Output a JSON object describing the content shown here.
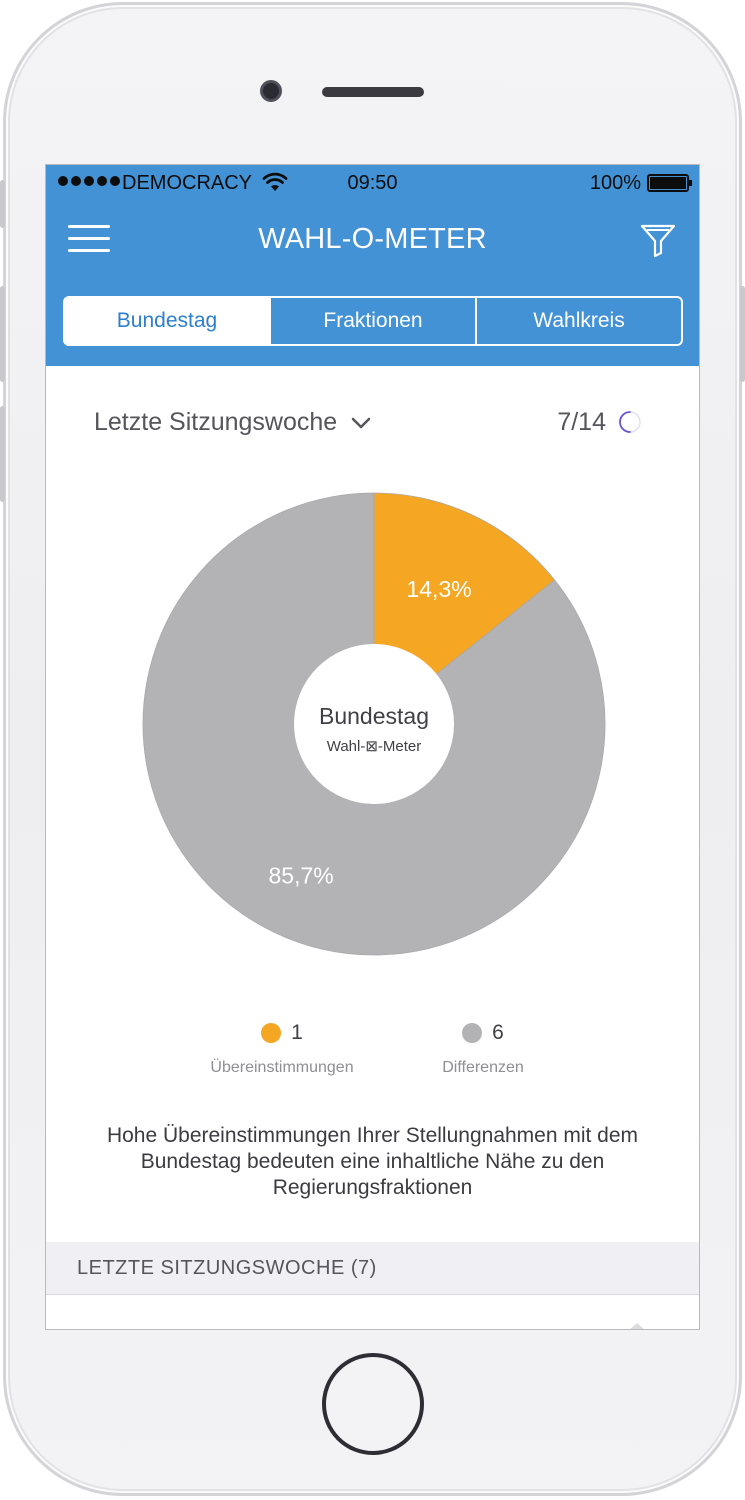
{
  "status_bar": {
    "carrier": "DEMOCRACY",
    "time": "09:50",
    "battery_percent": "100%",
    "battery_level": 1.0
  },
  "header": {
    "title": "WAHL-O-METER",
    "menu_icon": "hamburger-menu-icon",
    "filter_icon": "filter-funnel-icon",
    "background_color": "#4392d5"
  },
  "tabs": [
    {
      "label": "Bundestag",
      "active": true
    },
    {
      "label": "Fraktionen",
      "active": false
    },
    {
      "label": "Wahlkreis",
      "active": false
    }
  ],
  "filter": {
    "period_label": "Letzte Sitzungswoche",
    "progress_text": "7/14",
    "progress_fraction": 0.5
  },
  "chart_data": {
    "type": "pie",
    "center_title": "Bundestag",
    "center_subtitle": "Wahl-⊠-Meter",
    "slices": [
      {
        "label": "Übereinstimmungen",
        "value": 1,
        "percent_label": "14,3%",
        "color": "#f5a623"
      },
      {
        "label": "Differenzen",
        "value": 6,
        "percent_label": "85,7%",
        "color": "#b3b3b5"
      }
    ]
  },
  "legend": [
    {
      "count": "1",
      "label": "Übereinstimmungen",
      "color": "#f5a623"
    },
    {
      "count": "6",
      "label": "Differenzen",
      "color": "#b3b3b5"
    }
  ],
  "info_text": "Hohe Übereinstimmungen Ihrer Stellungnahmen mit dem Bundestag bedeuten eine inhaltliche Nähe zu den Regierungsfraktionen",
  "section": {
    "title": "LETZTE SITZUNGSWOCHE (7)"
  }
}
